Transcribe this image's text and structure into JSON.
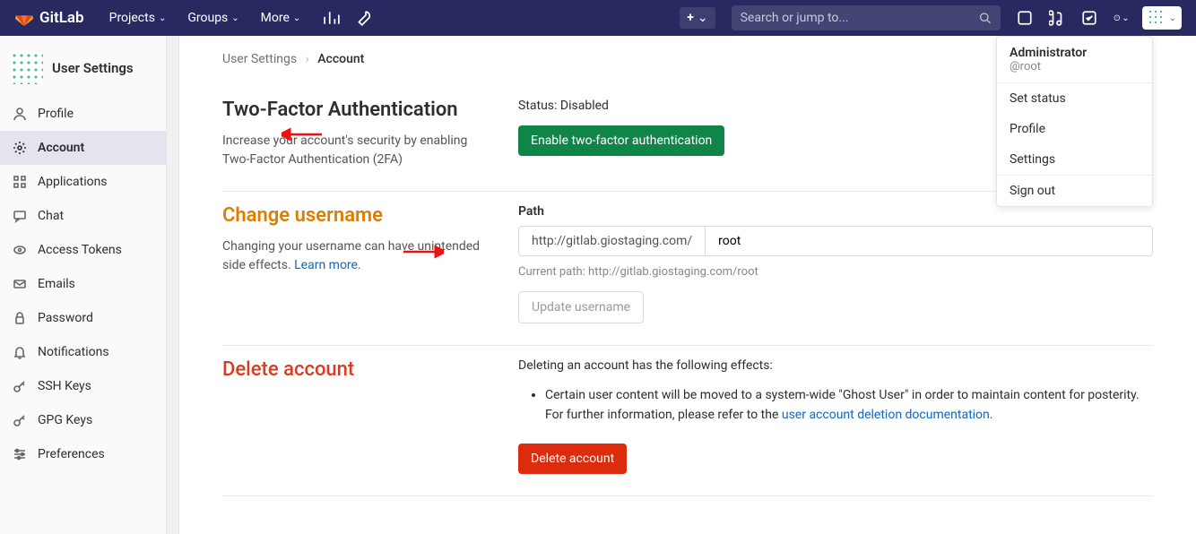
{
  "brand": "GitLab",
  "nav": {
    "projects": "Projects",
    "groups": "Groups",
    "more": "More"
  },
  "search": {
    "placeholder": "Search or jump to..."
  },
  "sidebar": {
    "title": "User Settings",
    "items": [
      {
        "label": "Profile"
      },
      {
        "label": "Account"
      },
      {
        "label": "Applications"
      },
      {
        "label": "Chat"
      },
      {
        "label": "Access Tokens"
      },
      {
        "label": "Emails"
      },
      {
        "label": "Password"
      },
      {
        "label": "Notifications"
      },
      {
        "label": "SSH Keys"
      },
      {
        "label": "GPG Keys"
      },
      {
        "label": "Preferences"
      }
    ]
  },
  "breadcrumb": {
    "root": "User Settings",
    "current": "Account"
  },
  "twofa": {
    "title": "Two-Factor Authentication",
    "desc": "Increase your account's security by enabling Two-Factor Authentication (2FA)",
    "status": "Status: Disabled",
    "button": "Enable two-factor authentication"
  },
  "username": {
    "title": "Change username",
    "desc1": "Changing your username can have unintended side effects. ",
    "learn": "Learn more",
    "path_label": "Path",
    "prefix": "http://gitlab.giostaging.com/",
    "value": "root",
    "hint": "Current path: http://gitlab.giostaging.com/root",
    "button": "Update username"
  },
  "delete": {
    "title": "Delete account",
    "intro": "Deleting an account has the following effects:",
    "bullet1a": "Certain user content will be moved to a system-wide \"Ghost User\" in order to maintain content for posterity. For further information, please refer to the ",
    "bullet1b": "user account deletion documentation",
    "button": "Delete account"
  },
  "dropdown": {
    "name": "Administrator",
    "handle": "@root",
    "items": [
      "Set status",
      "Profile",
      "Settings",
      "Sign out"
    ]
  }
}
